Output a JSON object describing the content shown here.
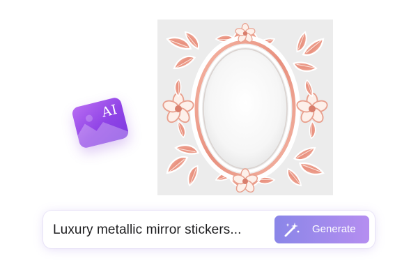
{
  "badge": {
    "text": "AI",
    "icon": "image-mountain-icon",
    "color": "#8f43e6"
  },
  "preview": {
    "subject": "ornate-oval-mirror-sticker",
    "icon": "mirror-sticker-image"
  },
  "prompt": {
    "value": "Luxury metallic mirror stickers...",
    "generate_label": "Generate",
    "generate_icon": "magic-wand-icon",
    "accent_start": "#8a86e8",
    "accent_end": "#b58ef0"
  }
}
